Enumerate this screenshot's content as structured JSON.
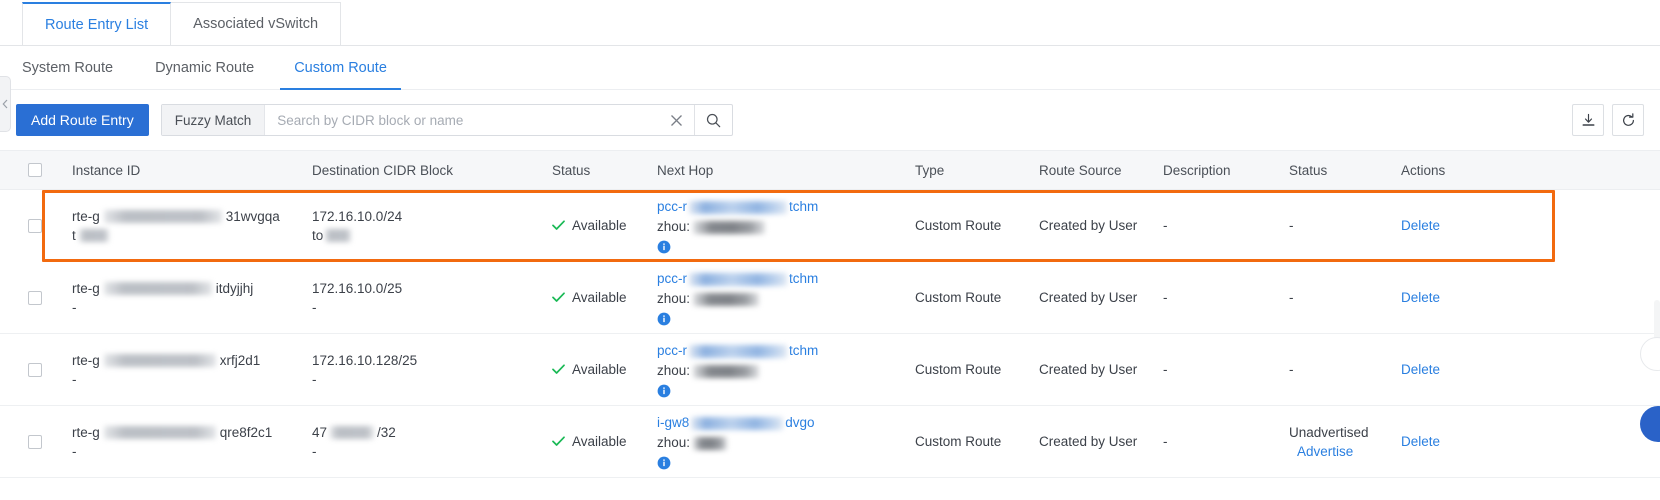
{
  "tabs": {
    "primary": [
      {
        "label": "Route Entry List",
        "active": true
      },
      {
        "label": "Associated vSwitch",
        "active": false
      }
    ],
    "secondary": [
      {
        "label": "System Route",
        "active": false
      },
      {
        "label": "Dynamic Route",
        "active": false
      },
      {
        "label": "Custom Route",
        "active": true
      }
    ]
  },
  "toolbar": {
    "add_button": "Add Route Entry",
    "fuzzy_label": "Fuzzy Match",
    "search_value": "",
    "search_placeholder": "Search by CIDR block or name",
    "clear_icon": "close-icon",
    "search_icon": "search-icon",
    "download_icon": "download-icon",
    "refresh_icon": "refresh-icon"
  },
  "sidebar_handle": {
    "icon": "chevron-left-icon"
  },
  "table": {
    "columns": [
      "Instance ID",
      "Destination CIDR Block",
      "Status",
      "Next Hop",
      "Type",
      "Route Source",
      "Description",
      "Status",
      "Actions"
    ],
    "rows": [
      {
        "highlighted": true,
        "instance_id_prefix": "rte-g",
        "instance_id_suffix": "31wvgqa",
        "instance_id_line2_prefix": "t",
        "instance_id_line2_redacted": true,
        "cidr_line1": "172.16.10.0/24",
        "cidr_line2_prefix": "to",
        "cidr_line2_redacted": true,
        "status": "Available",
        "status_icon": "check-icon",
        "hop_prefix": "pcc-r",
        "hop_suffix": "tchm",
        "hop_line2_prefix": "zhou:",
        "hop_info_icon": "info-icon",
        "type": "Custom Route",
        "route_source": "Created by User",
        "description": "-",
        "advertise_status": "-",
        "advertise_action": "",
        "action": "Delete"
      },
      {
        "highlighted": false,
        "instance_id_prefix": "rte-g",
        "instance_id_suffix": "itdyjjhj",
        "instance_id_line2_prefix": "-",
        "instance_id_line2_redacted": false,
        "cidr_line1": "172.16.10.0/25",
        "cidr_line2_prefix": "-",
        "cidr_line2_redacted": false,
        "status": "Available",
        "status_icon": "check-icon",
        "hop_prefix": "pcc-r",
        "hop_suffix": "tchm",
        "hop_line2_prefix": "zhou:",
        "hop_info_icon": "info-icon",
        "type": "Custom Route",
        "route_source": "Created by User",
        "description": "-",
        "advertise_status": "-",
        "advertise_action": "",
        "action": "Delete"
      },
      {
        "highlighted": false,
        "instance_id_prefix": "rte-g",
        "instance_id_suffix": "xrfj2d1",
        "instance_id_line2_prefix": "-",
        "instance_id_line2_redacted": false,
        "cidr_line1": "172.16.10.128/25",
        "cidr_line2_prefix": "-",
        "cidr_line2_redacted": false,
        "status": "Available",
        "status_icon": "check-icon",
        "hop_prefix": "pcc-r",
        "hop_suffix": "tchm",
        "hop_line2_prefix": "zhou:",
        "hop_info_icon": "info-icon",
        "type": "Custom Route",
        "route_source": "Created by User",
        "description": "-",
        "advertise_status": "-",
        "advertise_action": "",
        "action": "Delete"
      },
      {
        "highlighted": false,
        "instance_id_prefix": "rte-g",
        "instance_id_suffix": "qre8f2c1",
        "instance_id_line2_prefix": "-",
        "instance_id_line2_redacted": false,
        "cidr_line1_prefix": "47",
        "cidr_line1_suffix": "/32",
        "cidr_line1_redacted": true,
        "cidr_line2_prefix": "-",
        "cidr_line2_redacted": false,
        "status": "Available",
        "status_icon": "check-icon",
        "hop_prefix": "i-gw8",
        "hop_suffix": "dvgo",
        "hop_line2_prefix": "zhou:",
        "hop_info_icon": "info-icon",
        "type": "Custom Route",
        "route_source": "Created by User",
        "description": "-",
        "advertise_status": "Unadvertised",
        "advertise_action": "Advertise",
        "action": "Delete"
      }
    ]
  },
  "colors": {
    "accent_blue": "#2a7fe0",
    "button_blue": "#2a6fd4",
    "highlight_orange": "#f26a0f",
    "success_green": "#19b955",
    "float_blue": "#2a62c8"
  }
}
